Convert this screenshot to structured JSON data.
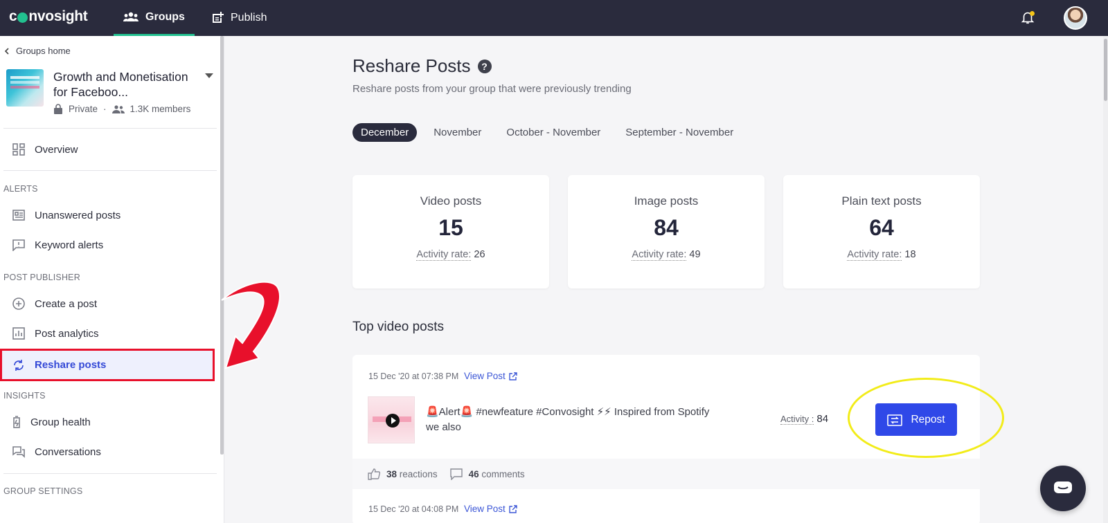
{
  "app": {
    "logo": "Convosight"
  },
  "topnav": {
    "groups_label": "Groups",
    "publish_label": "Publish"
  },
  "sidebar": {
    "back_label": "Groups home",
    "group": {
      "name": "Growth and Monetisation for Faceboo...",
      "privacy": "Private",
      "members": "1.3K members"
    },
    "overview": "Overview",
    "sections": {
      "alerts": "ALERTS",
      "post_publisher": "POST PUBLISHER",
      "insights": "INSIGHTS",
      "group_settings": "GROUP SETTINGS"
    },
    "items": {
      "unanswered": "Unanswered posts",
      "keyword": "Keyword alerts",
      "create": "Create a post",
      "analytics": "Post analytics",
      "reshare": "Reshare posts",
      "health": "Group health",
      "conversations": "Conversations"
    }
  },
  "main": {
    "title": "Reshare Posts",
    "subtitle": "Reshare posts from your group that were previously trending",
    "tabs": [
      "December",
      "November",
      "October - November",
      "September - November"
    ],
    "active_tab": "December",
    "stats": [
      {
        "label": "Video posts",
        "value": "15",
        "rate_label": "Activity rate:",
        "rate": "26"
      },
      {
        "label": "Image posts",
        "value": "84",
        "rate_label": "Activity rate:",
        "rate": "49"
      },
      {
        "label": "Plain text posts",
        "value": "64",
        "rate_label": "Activity rate:",
        "rate": "18"
      }
    ],
    "top_video_title": "Top video posts",
    "posts": [
      {
        "date": "15 Dec '20 at 07:38 PM",
        "view_label": "View Post",
        "text": "🚨Alert🚨 #newfeature #Convosight ⚡⚡ Inspired from Spotify we also",
        "activity_label": "Activity :",
        "activity": "84",
        "repost_label": "Repost",
        "reactions_count": "38",
        "reactions_label": "reactions",
        "comments_count": "46",
        "comments_label": "comments"
      },
      {
        "date": "15 Dec '20 at 04:08 PM",
        "view_label": "View Post"
      }
    ]
  },
  "colors": {
    "topbar": "#2a2b3d",
    "accent_green": "#22c08f",
    "primary_blue": "#2f48e8",
    "highlight_red": "#e8102b",
    "highlight_yellow": "#f2ec19"
  }
}
